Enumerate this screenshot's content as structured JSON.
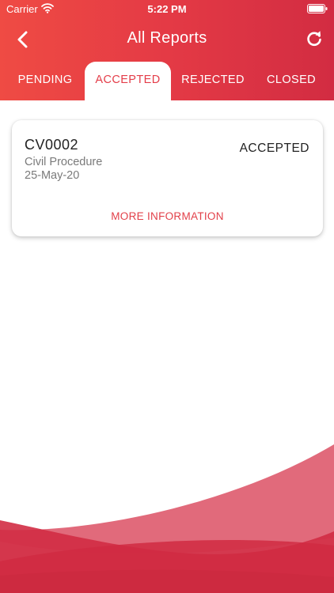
{
  "status_bar": {
    "carrier": "Carrier",
    "time": "5:22 PM",
    "icons": [
      "wifi-icon",
      "battery-icon"
    ]
  },
  "header": {
    "title": "All Reports",
    "back_icon": "chevron-left-icon",
    "refresh_icon": "refresh-icon"
  },
  "tabs": [
    {
      "label": "PENDING",
      "active": false
    },
    {
      "label": "ACCEPTED",
      "active": true
    },
    {
      "label": "REJECTED",
      "active": false
    },
    {
      "label": "CLOSED",
      "active": false
    }
  ],
  "reports": [
    {
      "id": "CV0002",
      "type": "Civil Procedure",
      "date": "25-May-20",
      "status": "ACCEPTED",
      "action_label": "MORE INFORMATION"
    }
  ],
  "colors": {
    "header_start": "#ef4b44",
    "header_end": "#d22c42",
    "accent": "#e43d49",
    "wave": "#d42c44"
  }
}
